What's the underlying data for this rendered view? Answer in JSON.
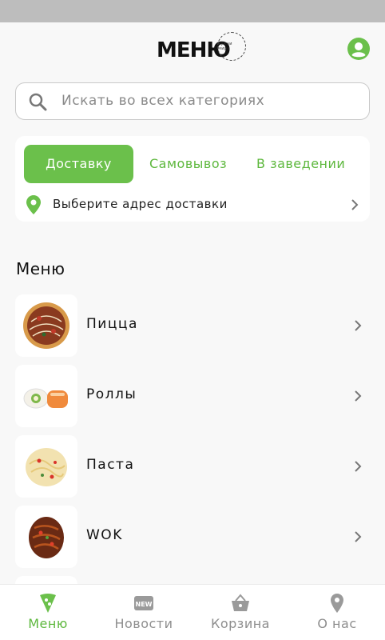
{
  "header": {
    "logo_text": "МЕНЮ",
    "logo_ring_text": "кухни мира"
  },
  "search": {
    "placeholder": "Искать во всех категориях"
  },
  "delivery": {
    "tabs": [
      {
        "label": "Доставку",
        "active": true
      },
      {
        "label": "Самовывоз",
        "active": false
      },
      {
        "label": "В заведении",
        "active": false
      }
    ],
    "address_prompt": "Выберите адрес доставки"
  },
  "menu": {
    "title": "Меню",
    "items": [
      {
        "label": "Пицца",
        "image": "pizza"
      },
      {
        "label": "Роллы",
        "image": "rolls"
      },
      {
        "label": "Паста",
        "image": "pasta"
      },
      {
        "label": "WOK",
        "image": "wok-noodles"
      }
    ]
  },
  "tabbar": {
    "items": [
      {
        "label": "Меню",
        "icon": "pizza-slice-icon",
        "active": true
      },
      {
        "label": "Новости",
        "icon": "new-badge-icon",
        "active": false
      },
      {
        "label": "Корзина",
        "icon": "basket-icon",
        "active": false
      },
      {
        "label": "О нас",
        "icon": "location-pin-icon",
        "active": false
      }
    ]
  },
  "colors": {
    "accent": "#6bc04b",
    "accent_text": "#5eb83e",
    "inactive": "#8e8e8e"
  }
}
